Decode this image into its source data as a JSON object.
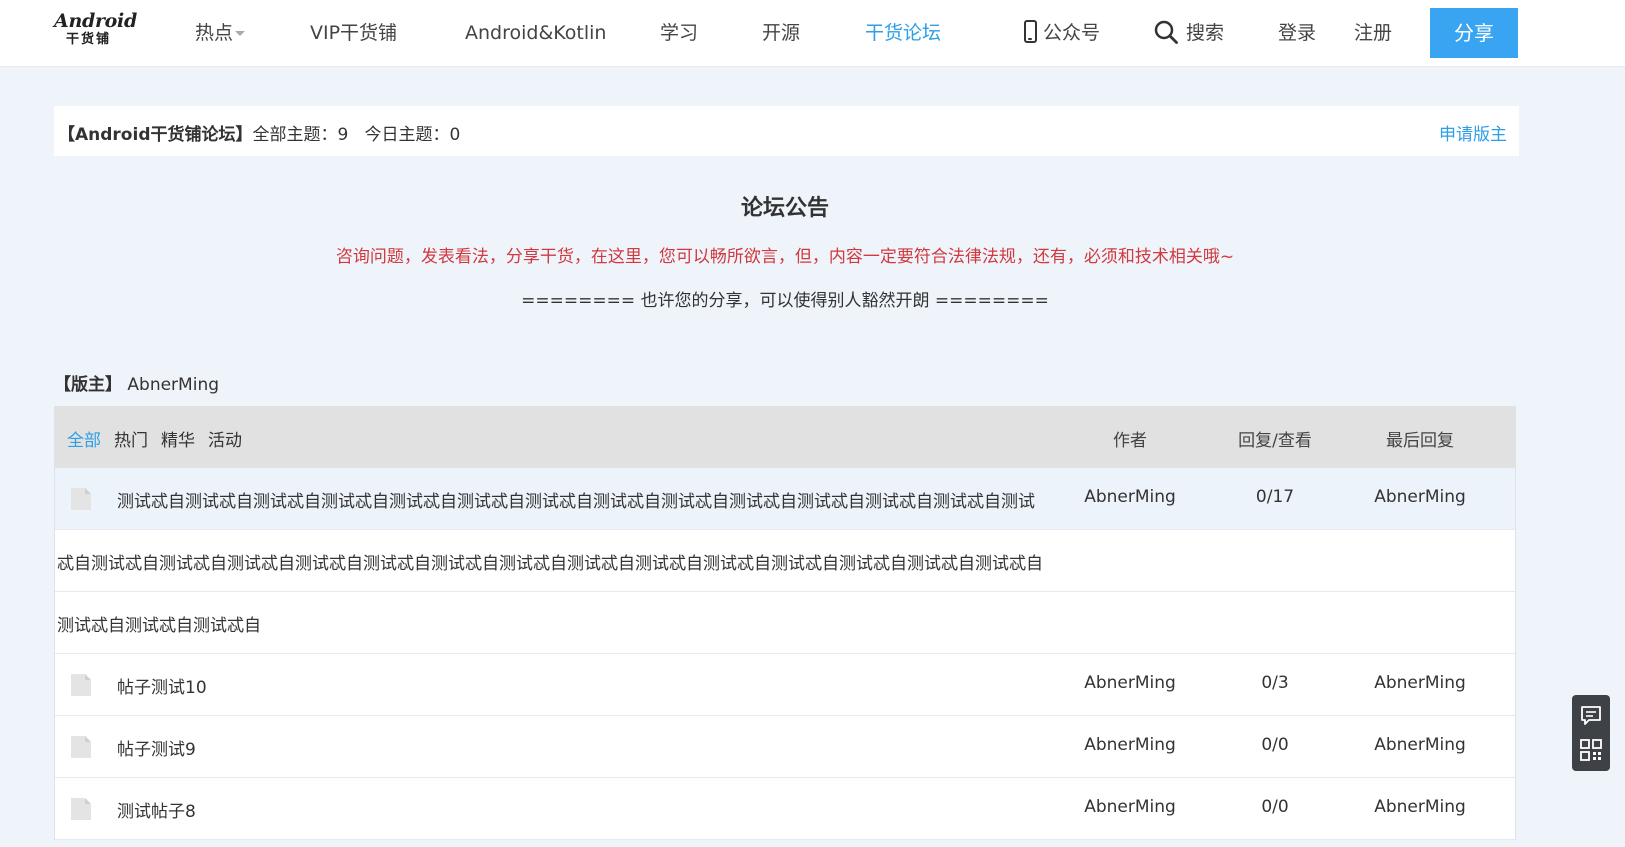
{
  "header": {
    "logo_line1": "Android",
    "logo_line2": "干货铺",
    "nav": {
      "hot": "热点",
      "vip": "VIP干货铺",
      "kotlin": "Android&Kotlin",
      "learn": "学习",
      "opensource": "开源",
      "forum": "干货论坛",
      "wechat": "公众号",
      "search": "搜索",
      "login": "登录",
      "register": "注册"
    },
    "share": "分享",
    "accent": "#2d9ee8"
  },
  "forum": {
    "name": "【Android干货铺论坛】",
    "all_label": "全部主题：",
    "all_count": "9",
    "today_label": "今日主题：",
    "today_count": "0",
    "apply": "申请版主"
  },
  "announcement": {
    "title": "论坛公告",
    "text": "咨询问题，发表看法，分享干货，在这里，您可以畅所欲言，但，内容一定要符合法律法规，还有，必须和技术相关哦~",
    "sub": "======== 也许您的分享，可以使得别人豁然开朗 ========",
    "text_color": "#d0393f"
  },
  "moderator": {
    "label": "【版主】",
    "name": "AbnerMing"
  },
  "table": {
    "filters": [
      "全部",
      "热门",
      "精华",
      "活动"
    ],
    "headers": {
      "author": "作者",
      "replies": "回复/查看",
      "last": "最后回复"
    },
    "rows": [
      {
        "title": "测试忒自测试忒自测试忒自测试忒自测试忒自测试忒自测试忒自测试忒自测试忒自测试忒自测试忒自测试忒自测试忒自测试",
        "title_cont1": "忒自测试忒自测试忒自测试忒自测试忒自测试忒自测试忒自测试忒自测试忒自测试忒自测试忒自测试忒自测试忒自测试忒自测试忒自",
        "title_cont2": "测试忒自测试忒自测试忒自",
        "author": "AbnerMing",
        "replies": "0/17",
        "last": "AbnerMing"
      },
      {
        "title": "帖子测试10",
        "author": "AbnerMing",
        "replies": "0/3",
        "last": "AbnerMing"
      },
      {
        "title": "帖子测试9",
        "author": "AbnerMing",
        "replies": "0/0",
        "last": "AbnerMing"
      },
      {
        "title": "测试帖子8",
        "author": "AbnerMing",
        "replies": "0/0",
        "last": "AbnerMing"
      }
    ]
  },
  "icons": {
    "doc": "document-icon",
    "chat": "chat-bubble-icon",
    "qr": "qr-code-icon",
    "phone": "phone-icon",
    "search": "search-icon"
  }
}
